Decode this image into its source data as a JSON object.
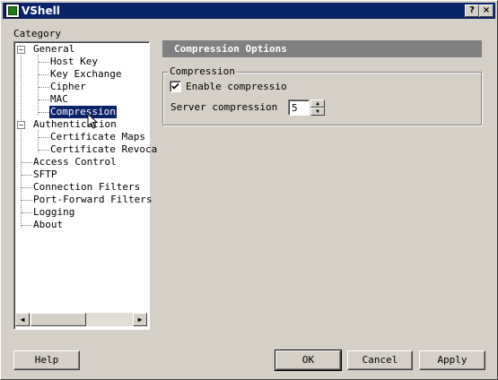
{
  "window": {
    "title": "VShell",
    "help_glyph": "?",
    "close_glyph": "×"
  },
  "sidebar": {
    "label": "Category",
    "tree": [
      {
        "label": "General",
        "expander": "−"
      },
      {
        "label": "Host Key"
      },
      {
        "label": "Key Exchange"
      },
      {
        "label": "Cipher"
      },
      {
        "label": "MAC"
      },
      {
        "label": "Compression",
        "selected": true
      },
      {
        "label": "Authentication",
        "expander": "−"
      },
      {
        "label": "Certificate Maps"
      },
      {
        "label": "Certificate Revoca"
      },
      {
        "label": "Access Control"
      },
      {
        "label": "SFTP"
      },
      {
        "label": "Connection Filters"
      },
      {
        "label": "Port-Forward Filters"
      },
      {
        "label": "Logging"
      },
      {
        "label": "About"
      }
    ],
    "scroll_left": "◀",
    "scroll_right": "▶"
  },
  "panel": {
    "header": "Compression Options",
    "group_title": "Compression",
    "enable_label": "Enable compressio",
    "enable_checked": true,
    "server_label": "Server compression",
    "server_value": "5",
    "spin_up": "▲",
    "spin_down": "▼"
  },
  "buttons": {
    "help": "Help",
    "ok": "OK",
    "cancel": "Cancel",
    "apply": "Apply"
  }
}
